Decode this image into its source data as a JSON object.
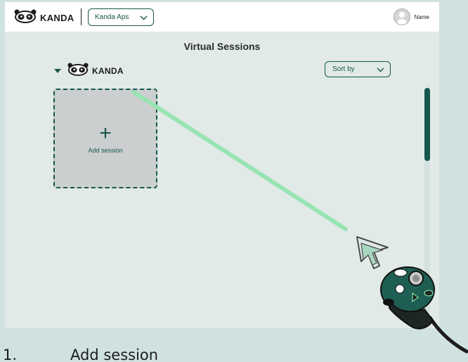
{
  "header": {
    "brand": "KANDA",
    "org_select": "Kanda Aps",
    "user_name": "Name"
  },
  "main": {
    "title": "Virtual Sessions",
    "group_name": "KANDA",
    "sort_label": "Sort by",
    "add_session_label": "Add session"
  },
  "caption": {
    "number": "1.",
    "text": "Add session"
  },
  "colors": {
    "accent": "#15574b",
    "laser": "#97e4b3",
    "background": "#e1eae7"
  },
  "icons": {
    "logo": "panda-logo-icon",
    "avatar": "user-avatar-icon",
    "add": "plus-icon",
    "controller": "vr-controller-icon",
    "cursor": "pointer-cursor-icon"
  }
}
